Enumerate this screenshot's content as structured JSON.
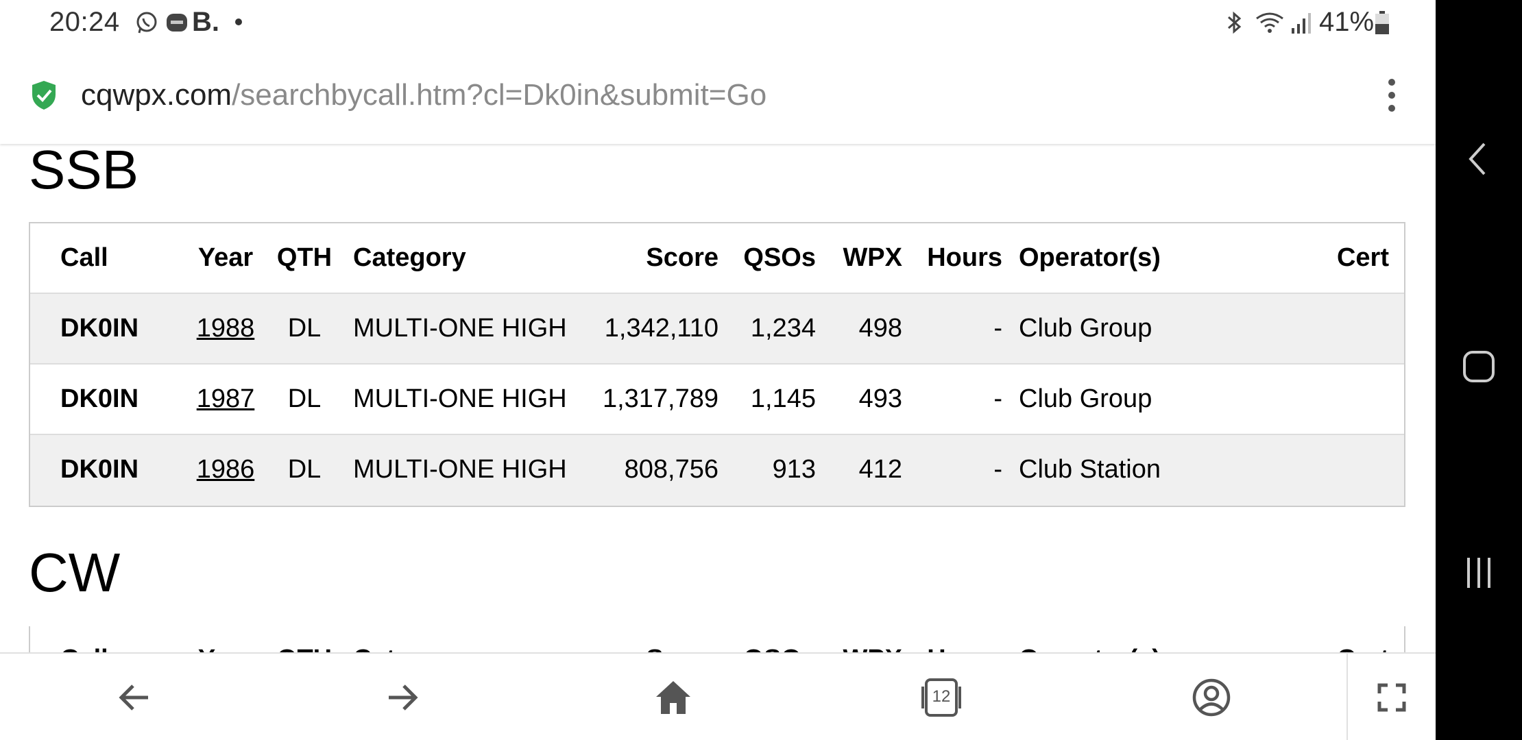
{
  "status_bar": {
    "time": "20:24",
    "brand_letter": "B.",
    "battery": "41%",
    "icons": [
      "whatsapp-icon",
      "wear-icon",
      "bluetooth-icon",
      "wifi-icon",
      "signal-icon",
      "battery-icon"
    ]
  },
  "url_bar": {
    "host": "cqwpx.com",
    "path": "/searchbycall.htm?cl=Dk0in&submit=Go"
  },
  "columns": {
    "call": "Call",
    "year": "Year",
    "qth": "QTH",
    "category": "Category",
    "score": "Score",
    "qsos": "QSOs",
    "wpx": "WPX",
    "hours": "Hours",
    "operators": "Operator(s)",
    "cert": "Cert"
  },
  "ssb": {
    "heading": "SSB",
    "rows": [
      {
        "call": "DK0IN",
        "year": "1988",
        "qth": "DL",
        "category": "MULTI-ONE HIGH",
        "score": "1,342,110",
        "qsos": "1,234",
        "wpx": "498",
        "hours": "-",
        "operators": "Club Group",
        "cert": ""
      },
      {
        "call": "DK0IN",
        "year": "1987",
        "qth": "DL",
        "category": "MULTI-ONE HIGH",
        "score": "1,317,789",
        "qsos": "1,145",
        "wpx": "493",
        "hours": "-",
        "operators": "Club Group",
        "cert": ""
      },
      {
        "call": "DK0IN",
        "year": "1986",
        "qth": "DL",
        "category": "MULTI-ONE HIGH",
        "score": "808,756",
        "qsos": "913",
        "wpx": "412",
        "hours": "-",
        "operators": "Club Station",
        "cert": ""
      }
    ]
  },
  "cw": {
    "heading": "CW"
  },
  "toolbar": {
    "tab_count": "12",
    "icons": [
      "back-arrow-icon",
      "forward-arrow-icon",
      "home-icon",
      "tabs-icon",
      "account-icon",
      "fullscreen-icon"
    ]
  },
  "colors": {
    "shield": "#34a853",
    "row_shade": "#f0f0f0",
    "url_path": "#8a8a8a"
  }
}
